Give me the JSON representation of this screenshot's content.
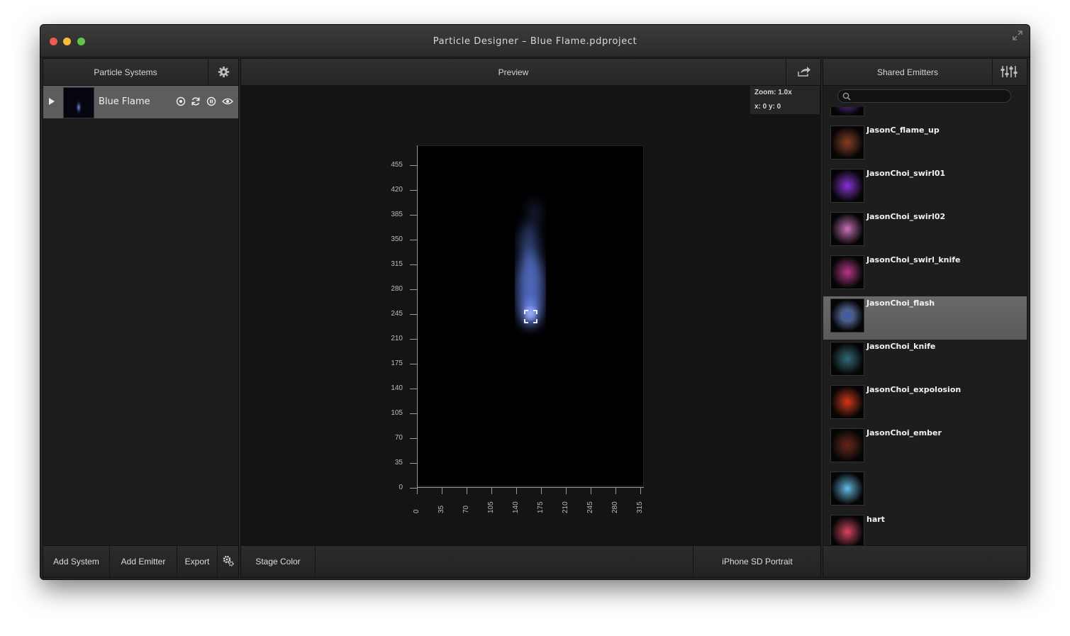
{
  "window": {
    "title": "Particle Designer – Blue Flame.pdproject"
  },
  "left_panel": {
    "header": "Particle Systems",
    "system": {
      "name": "Blue Flame"
    },
    "footer": {
      "add_system": "Add System",
      "add_emitter": "Add Emitter",
      "export": "Export"
    }
  },
  "center_panel": {
    "header": "Preview",
    "zoom": "Zoom: 1.0x",
    "coords": "x: 0 y: 0",
    "y_ticks": [
      "455",
      "420",
      "385",
      "350",
      "315",
      "280",
      "245",
      "210",
      "175",
      "140",
      "105",
      "70",
      "35",
      "0"
    ],
    "x_ticks": [
      "0",
      "35",
      "70",
      "105",
      "140",
      "175",
      "210",
      "245",
      "280",
      "315"
    ],
    "footer": {
      "stage_color": "Stage Color",
      "device": "iPhone SD Portrait"
    }
  },
  "right_panel": {
    "header": "Shared Emitters",
    "search_placeholder": "",
    "emitters": [
      {
        "name": "",
        "color": "#7a2fd0"
      },
      {
        "name": "JasonC_flame_up",
        "color": "#8a3a1a"
      },
      {
        "name": "JasonChoi_swirl01",
        "color": "#8b2be0"
      },
      {
        "name": "JasonChoi_swirl02",
        "color": "#d070c0"
      },
      {
        "name": "JasonChoi_swirl_knife",
        "color": "#c0308a"
      },
      {
        "name": "JasonChoi_flash",
        "color": "#3a5ab0",
        "selected": true
      },
      {
        "name": "JasonChoi_knife",
        "color": "#2a6a7a"
      },
      {
        "name": "JasonChoi_expolosion",
        "color": "#e03010"
      },
      {
        "name": "JasonChoi_ember",
        "color": "#6a2010"
      },
      {
        "name": "",
        "color": "#60c0f0"
      },
      {
        "name": "hart",
        "color": "#e04060"
      }
    ]
  }
}
